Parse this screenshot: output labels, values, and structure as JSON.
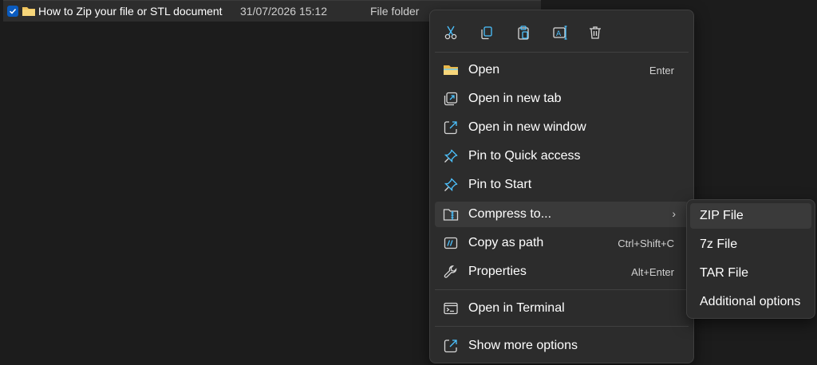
{
  "file": {
    "name": "How to Zip your file or STL document",
    "date": "31/07/2026 15:12",
    "type": "File folder",
    "selected": true
  },
  "toolbar": {
    "cut_icon": "cut-icon",
    "copy_icon": "copy-icon",
    "paste_icon": "paste-icon",
    "rename_icon": "rename-icon",
    "delete_icon": "delete-icon"
  },
  "menu": {
    "items": [
      {
        "label": "Open",
        "shortcut": "Enter",
        "icon": "folder-icon"
      },
      {
        "label": "Open in new tab",
        "shortcut": "",
        "icon": "new-tab-icon"
      },
      {
        "label": "Open in new window",
        "shortcut": "",
        "icon": "new-window-icon"
      },
      {
        "label": "Pin to Quick access",
        "shortcut": "",
        "icon": "pin-icon"
      },
      {
        "label": "Pin to Start",
        "shortcut": "",
        "icon": "pin-icon"
      },
      {
        "label": "Compress to...",
        "shortcut": "",
        "icon": "compress-icon",
        "has_submenu": true
      },
      {
        "label": "Copy as path",
        "shortcut": "Ctrl+Shift+C",
        "icon": "copy-path-icon"
      },
      {
        "label": "Properties",
        "shortcut": "Alt+Enter",
        "icon": "wrench-icon"
      },
      {
        "label": "Open in Terminal",
        "shortcut": "",
        "icon": "terminal-icon"
      },
      {
        "label": "Show more options",
        "shortcut": "",
        "icon": "more-options-icon"
      }
    ]
  },
  "submenu": {
    "items": [
      {
        "label": "ZIP File"
      },
      {
        "label": "7z File"
      },
      {
        "label": "TAR File"
      },
      {
        "label": "Additional options"
      }
    ]
  },
  "colors": {
    "background": "#1c1c1c",
    "menu": "#2c2c2c",
    "highlight": "#3a3a3a",
    "accent": "#4cc2ff",
    "folder": "#f2c55c"
  }
}
